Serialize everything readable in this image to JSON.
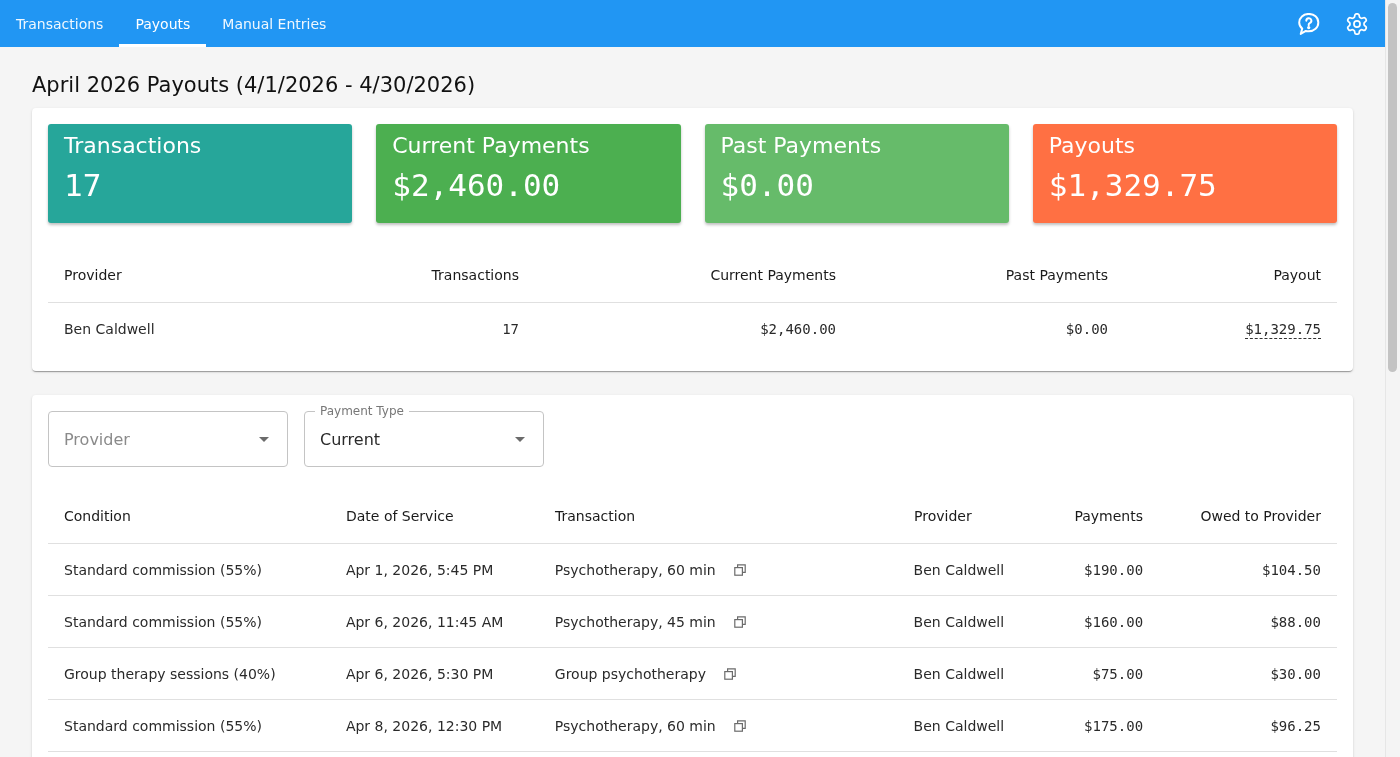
{
  "nav": {
    "tabs": [
      {
        "label": "Transactions",
        "selected": false
      },
      {
        "label": "Payouts",
        "selected": true
      },
      {
        "label": "Manual Entries",
        "selected": false
      }
    ]
  },
  "title": "April 2026 Payouts (4/1/2026 - 4/30/2026)",
  "summary": {
    "tiles": [
      {
        "label": "Transactions",
        "value": "17",
        "color": "#26a69a"
      },
      {
        "label": "Current Payments",
        "value": "$2,460.00",
        "color": "#4caf50"
      },
      {
        "label": "Past Payments",
        "value": "$0.00",
        "color": "#66bb6a"
      },
      {
        "label": "Payouts",
        "value": "$1,329.75",
        "color": "#ff7043"
      }
    ],
    "table": {
      "columns": [
        "Provider",
        "Transactions",
        "Current Payments",
        "Past Payments",
        "Payout"
      ],
      "rows": [
        {
          "provider": "Ben Caldwell",
          "transactions": "17",
          "current_payments": "$2,460.00",
          "past_payments": "$0.00",
          "payout": "$1,329.75",
          "payout_tooltip": true
        }
      ]
    }
  },
  "details": {
    "filters": [
      {
        "placeholder": "Provider"
      },
      {
        "label": "Payment Type",
        "value": "Current"
      }
    ],
    "table": {
      "columns": [
        "Condition",
        "Date of Service",
        "Transaction",
        "Provider",
        "Payments",
        "Owed to Provider"
      ],
      "rows": [
        {
          "condition": "Standard commission (55%)",
          "date_of_service": "Apr 1, 2026, 5:45 PM",
          "transaction": "Psychotherapy, 60 min",
          "provider": "Ben Caldwell",
          "payments": "$190.00",
          "owed_to_provider": "$104.50"
        },
        {
          "condition": "Standard commission (55%)",
          "date_of_service": "Apr 6, 2026, 11:45 AM",
          "transaction": "Psychotherapy, 45 min",
          "provider": "Ben Caldwell",
          "payments": "$160.00",
          "owed_to_provider": "$88.00"
        },
        {
          "condition": "Group therapy sessions (40%)",
          "date_of_service": "Apr 6, 2026, 5:30 PM",
          "transaction": "Group psychotherapy",
          "provider": "Ben Caldwell",
          "payments": "$75.00",
          "owed_to_provider": "$30.00"
        },
        {
          "condition": "Standard commission (55%)",
          "date_of_service": "Apr 8, 2026, 12:30 PM",
          "transaction": "Psychotherapy, 60 min",
          "provider": "Ben Caldwell",
          "payments": "$175.00",
          "owed_to_provider": "$96.25"
        }
      ]
    }
  }
}
